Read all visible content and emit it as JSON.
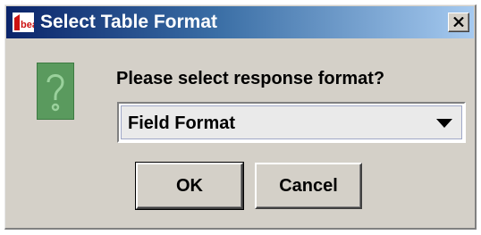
{
  "window": {
    "title": "Select Table Format",
    "close_glyph": "X",
    "app_icon": "bea-logo-icon"
  },
  "dialog": {
    "icon": "question-icon",
    "prompt": "Please select response format?",
    "format_select": {
      "selected": "Field Format"
    },
    "ok_label": "OK",
    "cancel_label": "Cancel"
  },
  "colors": {
    "titlebar_start": "#0a246a",
    "titlebar_end": "#a6caf0",
    "dialog_bg": "#d4d0c8",
    "question_icon_fill": "#5a9a5e"
  }
}
